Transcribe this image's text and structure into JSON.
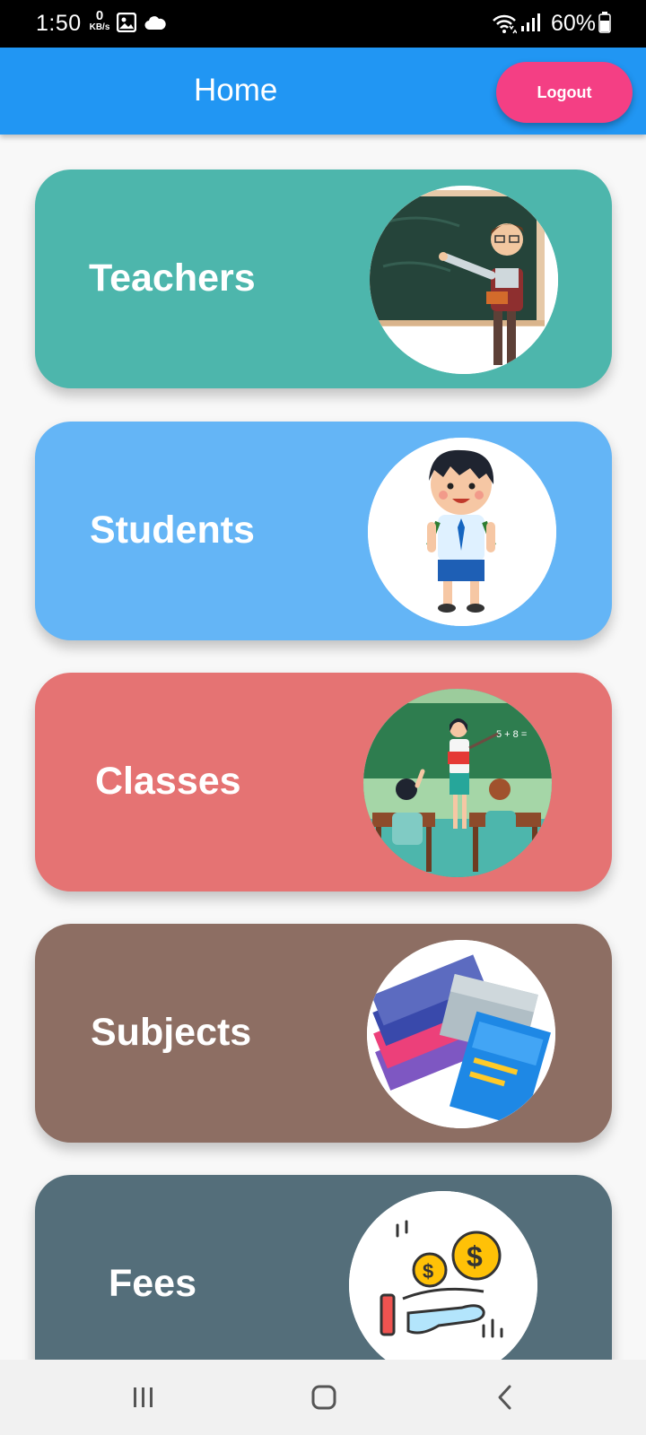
{
  "status_bar": {
    "time": "1:50",
    "net_speed_value": "0",
    "net_speed_unit": "KB/s",
    "battery_percent": "60%",
    "icons": [
      "gallery-icon",
      "cloud-icon",
      "wifi-icon",
      "signal-icon",
      "battery-icon"
    ]
  },
  "app_bar": {
    "title": "Home",
    "logout_label": "Logout",
    "color": "#2196f3",
    "logout_color": "#f43f84"
  },
  "cards": [
    {
      "label": "Teachers",
      "color": "#4db6ac",
      "icon": "teacher-illustration"
    },
    {
      "label": "Students",
      "color": "#64b5f6",
      "icon": "student-illustration"
    },
    {
      "label": "Classes",
      "color": "#e57373",
      "icon": "classroom-illustration"
    },
    {
      "label": "Subjects",
      "color": "#8d6e63",
      "icon": "books-illustration"
    },
    {
      "label": "Fees",
      "color": "#546e7a",
      "icon": "fees-illustration"
    }
  ],
  "nav_bar": {
    "buttons": [
      "recent-apps-icon",
      "home-icon",
      "back-icon"
    ]
  }
}
